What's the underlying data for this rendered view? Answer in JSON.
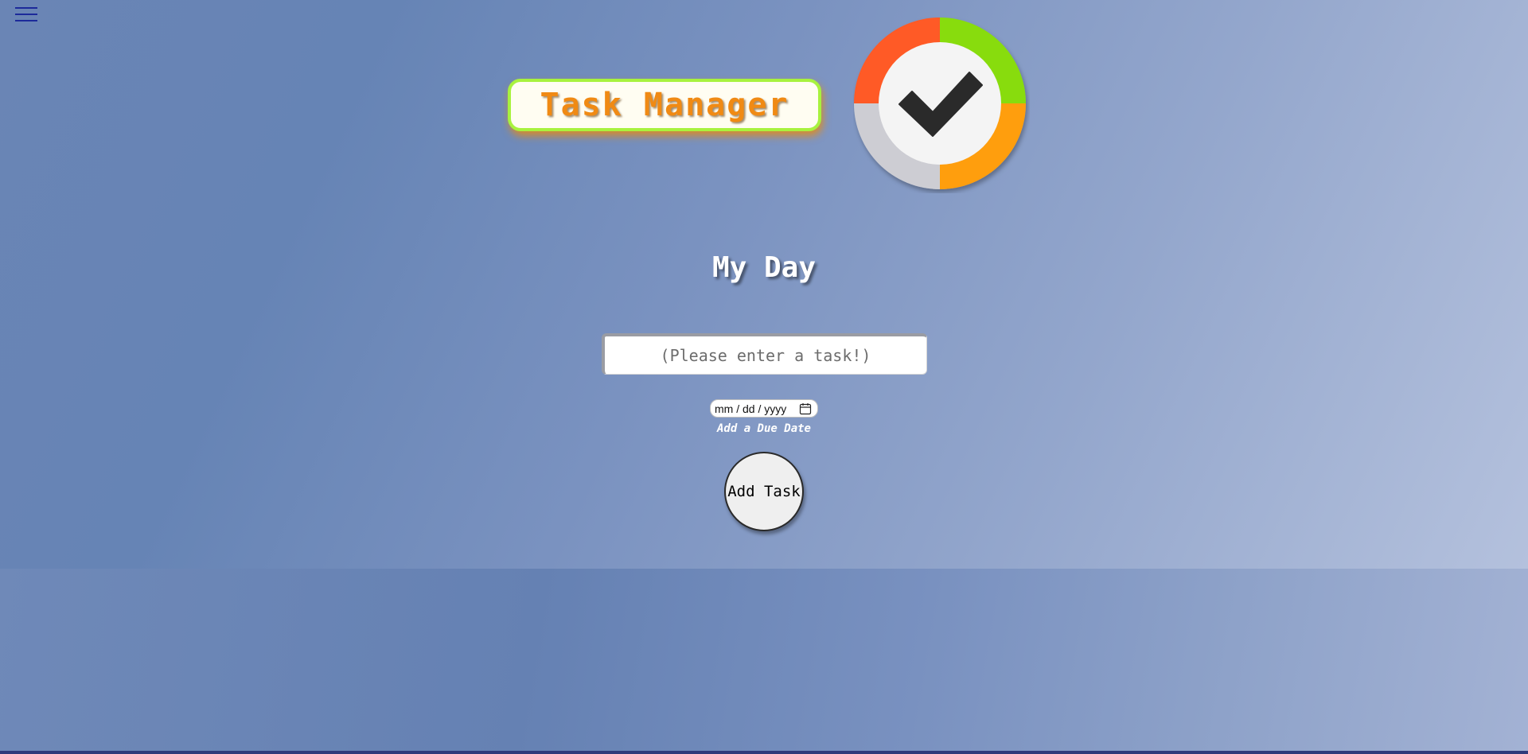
{
  "header": {
    "menu_icon": "hamburger-menu-icon",
    "title": "Task Manager",
    "logo_icon": "checkmark-circle-logo-icon"
  },
  "main": {
    "heading": "My Day",
    "task_input": {
      "value": "",
      "placeholder": "(Please enter a task!)"
    },
    "due_date": {
      "placeholder": "mm / dd / yyyy",
      "calendar_icon": "calendar-icon",
      "label": "Add a Due Date"
    },
    "add_button_label": "Add Task"
  },
  "colors": {
    "title_text": "#f08a14",
    "title_border": "#a8f23e",
    "logo_red": "#ff5a26",
    "logo_green": "#88dc10",
    "logo_orange": "#ff9e10",
    "logo_gray": "#cdcdd3",
    "check": "#2b2b2b",
    "menu_icon": "#1c2a9a",
    "bottom_rule": "#2f3a7a"
  }
}
